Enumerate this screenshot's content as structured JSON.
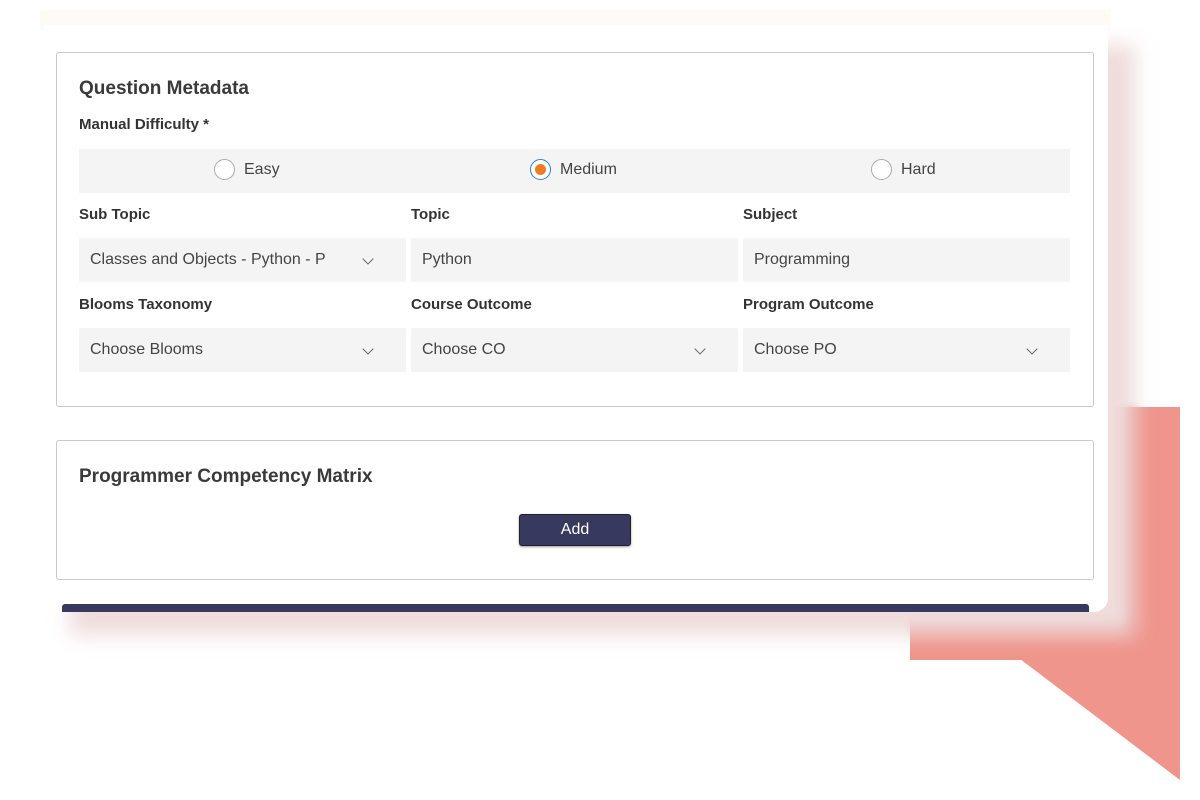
{
  "colors": {
    "accent": "#373a5e",
    "radio_selected": "#f07c22",
    "decoration": "#ef958c"
  },
  "metadata": {
    "title": "Question Metadata",
    "difficulty_label": "Manual Difficulty *",
    "difficulty_options": [
      {
        "label": "Easy",
        "selected": false
      },
      {
        "label": "Medium",
        "selected": true
      },
      {
        "label": "Hard",
        "selected": false
      }
    ],
    "sub_topic": {
      "label": "Sub Topic",
      "value": "Classes and Objects - Python - Programming"
    },
    "topic": {
      "label": "Topic",
      "value": "Python"
    },
    "subject": {
      "label": "Subject",
      "value": "Programming"
    },
    "blooms": {
      "label": "Blooms Taxonomy",
      "value": "Choose Blooms"
    },
    "course_outcome": {
      "label": "Course Outcome",
      "value": "Choose CO"
    },
    "program_outcome": {
      "label": "Program Outcome",
      "value": "Choose PO"
    }
  },
  "matrix": {
    "title": "Programmer Competency Matrix",
    "add_label": "Add"
  }
}
